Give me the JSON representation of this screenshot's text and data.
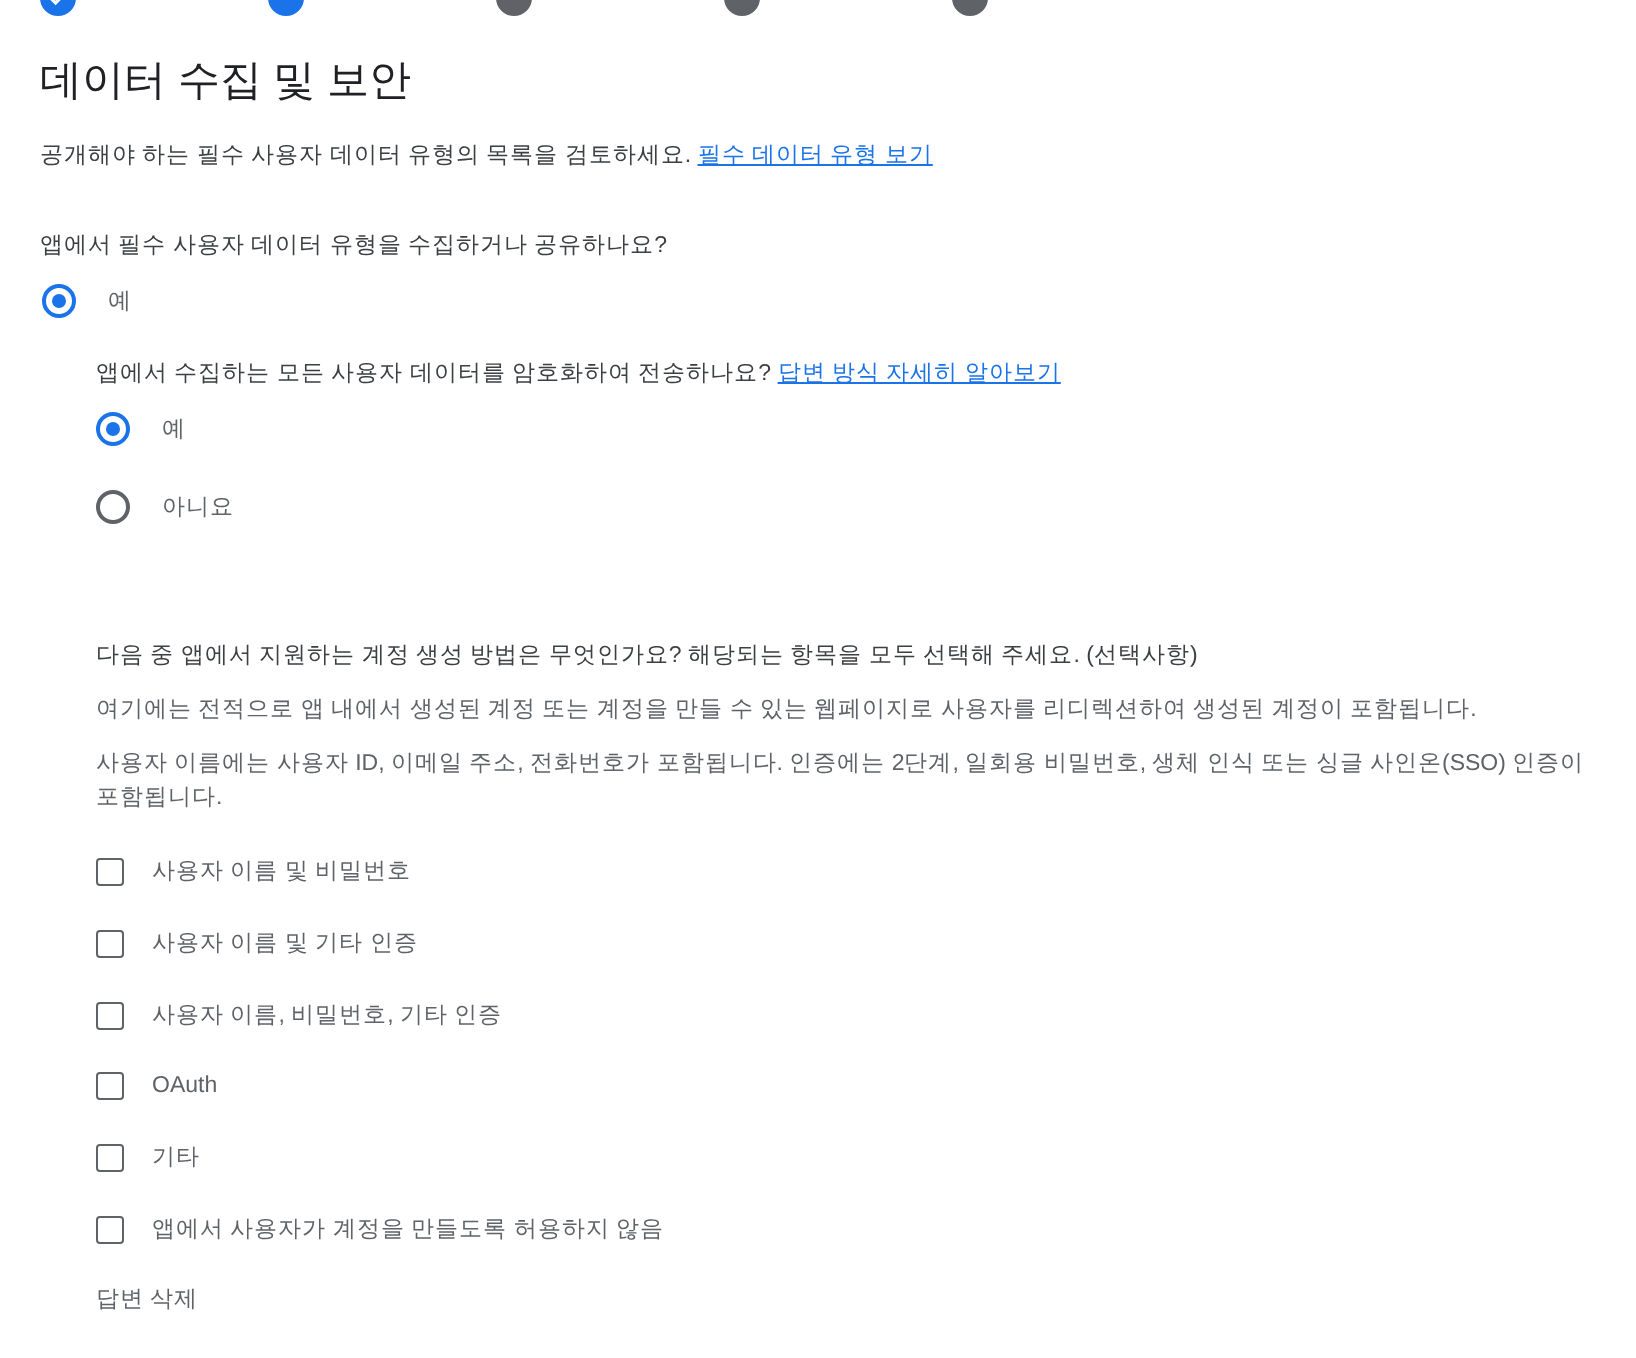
{
  "stepper": [
    {
      "kind": "done"
    },
    {
      "kind": "current"
    },
    {
      "kind": "todo"
    },
    {
      "kind": "todo"
    },
    {
      "kind": "todo"
    }
  ],
  "title": "데이터 수집 및 보안",
  "intro": {
    "text": "공개해야 하는 필수 사용자 데이터 유형의 목록을 검토하세요.",
    "link": "필수 데이터 유형 보기"
  },
  "collect_question": {
    "text": "앱에서 필수 사용자 데이터 유형을 수집하거나 공유하나요?",
    "options": [
      {
        "label": "예",
        "selected": true
      }
    ]
  },
  "encrypt_question": {
    "text": "앱에서 수집하는 모든 사용자 데이터를 암호화하여 전송하나요?",
    "link": "답변 방식 자세히 알아보기",
    "options": [
      {
        "label": "예",
        "selected": true
      },
      {
        "label": "아니요",
        "selected": false
      }
    ]
  },
  "account_question": {
    "text": "다음 중 앱에서 지원하는 계정 생성 방법은 무엇인가요? 해당되는 항목을 모두 선택해 주세요. (선택사항)",
    "notes": [
      "여기에는 전적으로 앱 내에서 생성된 계정 또는 계정을 만들 수 있는 웹페이지로 사용자를 리디렉션하여 생성된 계정이 포함됩니다.",
      "사용자 이름에는 사용자 ID, 이메일 주소, 전화번호가 포함됩니다. 인증에는 2단계, 일회용 비밀번호, 생체 인식 또는 싱글 사인온(SSO) 인증이 포함됩니다."
    ],
    "options": [
      {
        "label": "사용자 이름 및 비밀번호",
        "checked": false
      },
      {
        "label": "사용자 이름 및 기타 인증",
        "checked": false
      },
      {
        "label": "사용자 이름, 비밀번호, 기타 인증",
        "checked": false
      },
      {
        "label": "OAuth",
        "checked": false
      },
      {
        "label": "기타",
        "checked": false
      },
      {
        "label": "앱에서 사용자가 계정을 만들도록 허용하지 않음",
        "checked": false
      }
    ]
  },
  "clear_answer": "답변 삭제"
}
